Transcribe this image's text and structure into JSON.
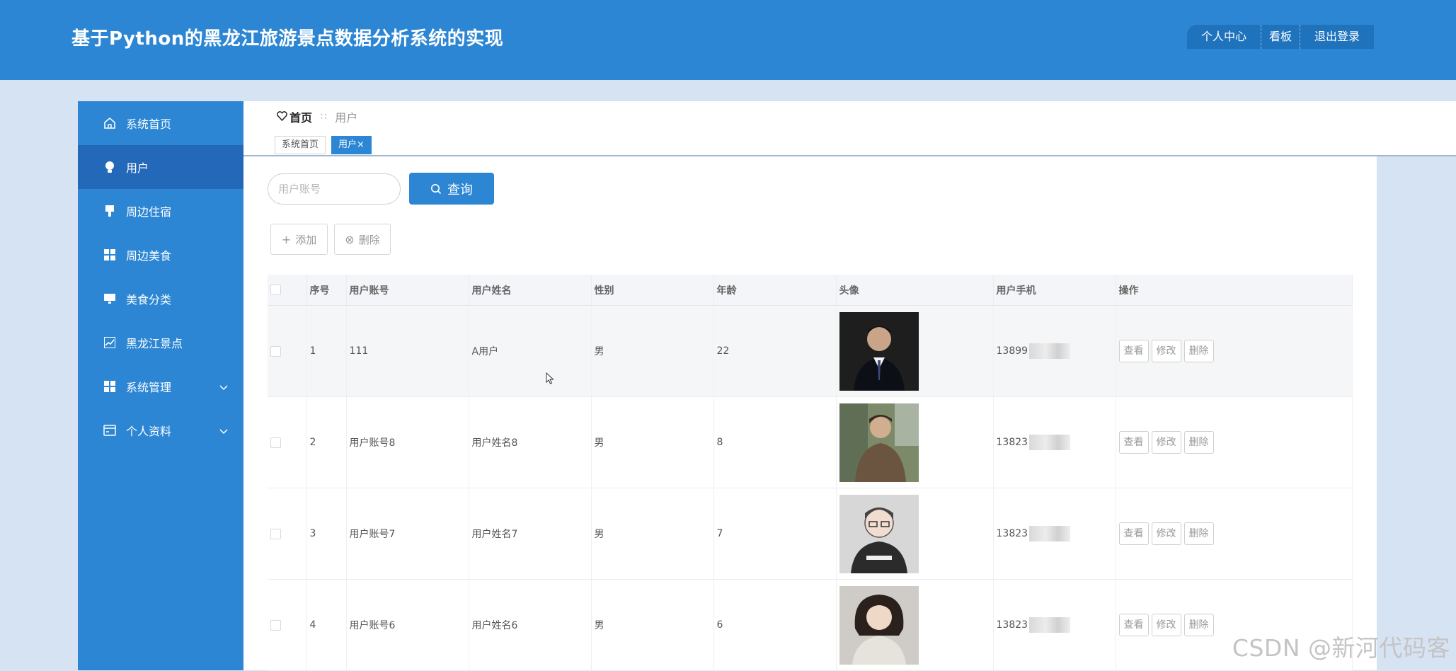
{
  "app": {
    "title": "基于Python的黑龙江旅游景点数据分析系统的实现"
  },
  "top_nav": {
    "personal_center": "个人中心",
    "dashboard": "看板",
    "logout": "退出登录"
  },
  "colors": {
    "primary": "#2c86d4",
    "sidebar_active": "#2468b9",
    "page_background": "#d6e3f2"
  },
  "sidebar": {
    "items": [
      {
        "label": "系统首页",
        "icon": "home-icon"
      },
      {
        "label": "用户",
        "icon": "user-bulb-icon"
      },
      {
        "label": "周边住宿",
        "icon": "hotel-icon"
      },
      {
        "label": "周边美食",
        "icon": "grid-icon"
      },
      {
        "label": "美食分类",
        "icon": "monitor-icon"
      },
      {
        "label": "黑龙江景点",
        "icon": "chart-line-icon"
      },
      {
        "label": "系统管理",
        "icon": "grid-icon"
      },
      {
        "label": "个人资料",
        "icon": "card-icon"
      }
    ]
  },
  "breadcrumb": {
    "home": "首页",
    "separator": "∷",
    "current": "用户"
  },
  "tabs": [
    {
      "label": "系统首页"
    },
    {
      "label": "用户",
      "close": "×"
    }
  ],
  "search": {
    "placeholder": "用户账号",
    "button_label": "查询"
  },
  "actions": {
    "add_symbol": "+",
    "add": "添加",
    "delete_symbol": "⊗",
    "delete": "删除"
  },
  "table": {
    "headers": [
      "序号",
      "用户账号",
      "用户姓名",
      "性别",
      "年龄",
      "头像",
      "用户手机",
      "操作"
    ],
    "row_actions": {
      "view": "查看",
      "edit": "修改",
      "delete": "删除"
    },
    "rows": [
      {
        "index": "1",
        "account": "111",
        "name": "A用户",
        "gender": "男",
        "age": "22",
        "avatar": "avatar-icon",
        "phone": "13899"
      },
      {
        "index": "2",
        "account": "用户账号8",
        "name": "用户姓名8",
        "gender": "男",
        "age": "8",
        "avatar": "avatar-icon",
        "phone": "13823"
      },
      {
        "index": "3",
        "account": "用户账号7",
        "name": "用户姓名7",
        "gender": "男",
        "age": "7",
        "avatar": "avatar-icon",
        "phone": "13823"
      },
      {
        "index": "4",
        "account": "用户账号6",
        "name": "用户姓名6",
        "gender": "男",
        "age": "6",
        "avatar": "avatar-icon",
        "phone": "13823"
      }
    ]
  },
  "watermark": "CSDN @新河代码客"
}
